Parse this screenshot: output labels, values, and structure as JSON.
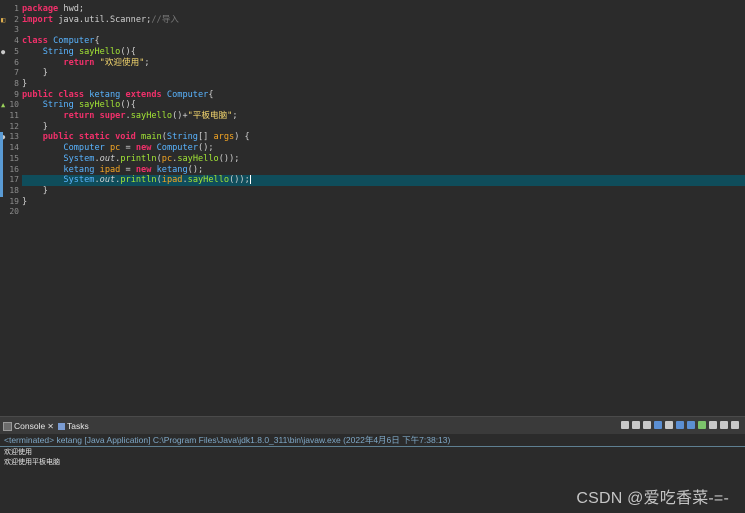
{
  "editor": {
    "line_numbers": [
      "1",
      "2",
      "3",
      "4",
      "5",
      "6",
      "7",
      "8",
      "9",
      "10",
      "11",
      "12",
      "13",
      "14",
      "15",
      "16",
      "17",
      "18",
      "19",
      "20"
    ],
    "code_tokens": {
      "l1": [
        {
          "t": "kw",
          "v": "package"
        },
        {
          "t": "def",
          "v": " hwd;"
        }
      ],
      "l2": [
        {
          "t": "kw",
          "v": "import"
        },
        {
          "t": "def",
          "v": " java.util.Scanner;"
        },
        {
          "t": "cm",
          "v": "//导入"
        }
      ],
      "l3": [],
      "l4": [
        {
          "t": "kw",
          "v": "class"
        },
        {
          "t": "def",
          "v": " "
        },
        {
          "t": "ty",
          "v": "Computer"
        },
        {
          "t": "def",
          "v": "{"
        }
      ],
      "l5": [
        {
          "t": "def",
          "v": "    "
        },
        {
          "t": "ty",
          "v": "String"
        },
        {
          "t": "def",
          "v": " "
        },
        {
          "t": "fn",
          "v": "sayHello"
        },
        {
          "t": "def",
          "v": "(){"
        }
      ],
      "l6": [
        {
          "t": "def",
          "v": "        "
        },
        {
          "t": "kw",
          "v": "return"
        },
        {
          "t": "def",
          "v": " "
        },
        {
          "t": "str",
          "v": "\"欢迎使用\""
        },
        {
          "t": "def",
          "v": ";"
        }
      ],
      "l7": [
        {
          "t": "def",
          "v": "    }"
        }
      ],
      "l8": [
        {
          "t": "def",
          "v": "}"
        }
      ],
      "l9": [
        {
          "t": "kw",
          "v": "public class"
        },
        {
          "t": "def",
          "v": " "
        },
        {
          "t": "ty",
          "v": "ketang"
        },
        {
          "t": "def",
          "v": " "
        },
        {
          "t": "kw",
          "v": "extends"
        },
        {
          "t": "def",
          "v": " "
        },
        {
          "t": "ty",
          "v": "Computer"
        },
        {
          "t": "def",
          "v": "{"
        }
      ],
      "l10": [
        {
          "t": "def",
          "v": "    "
        },
        {
          "t": "ty",
          "v": "String"
        },
        {
          "t": "def",
          "v": " "
        },
        {
          "t": "fn",
          "v": "sayHello"
        },
        {
          "t": "def",
          "v": "(){"
        }
      ],
      "l11": [
        {
          "t": "def",
          "v": "        "
        },
        {
          "t": "kw",
          "v": "return super"
        },
        {
          "t": "def",
          "v": "."
        },
        {
          "t": "fn",
          "v": "sayHello"
        },
        {
          "t": "def",
          "v": "()+"
        },
        {
          "t": "str",
          "v": "\"平板电脑\""
        },
        {
          "t": "def",
          "v": ";"
        }
      ],
      "l12": [
        {
          "t": "def",
          "v": "    }"
        }
      ],
      "l13": [
        {
          "t": "def",
          "v": "    "
        },
        {
          "t": "kw",
          "v": "public static void"
        },
        {
          "t": "def",
          "v": " "
        },
        {
          "t": "fn",
          "v": "main"
        },
        {
          "t": "def",
          "v": "("
        },
        {
          "t": "ty",
          "v": "String"
        },
        {
          "t": "def",
          "v": "[] "
        },
        {
          "t": "st",
          "v": "args"
        },
        {
          "t": "def",
          "v": ") {"
        }
      ],
      "l14": [
        {
          "t": "def",
          "v": "        "
        },
        {
          "t": "ty",
          "v": "Computer"
        },
        {
          "t": "def",
          "v": " "
        },
        {
          "t": "st",
          "v": "pc"
        },
        {
          "t": "def",
          "v": " = "
        },
        {
          "t": "kw",
          "v": "new"
        },
        {
          "t": "def",
          "v": " "
        },
        {
          "t": "ty",
          "v": "Computer"
        },
        {
          "t": "def",
          "v": "();"
        }
      ],
      "l15": [
        {
          "t": "def",
          "v": "        "
        },
        {
          "t": "ty",
          "v": "System"
        },
        {
          "t": "def",
          "v": "."
        },
        {
          "t": "it",
          "v": "out"
        },
        {
          "t": "def",
          "v": "."
        },
        {
          "t": "fn",
          "v": "println"
        },
        {
          "t": "def",
          "v": "("
        },
        {
          "t": "st",
          "v": "pc"
        },
        {
          "t": "def",
          "v": "."
        },
        {
          "t": "fn",
          "v": "sayHello"
        },
        {
          "t": "def",
          "v": "());"
        }
      ],
      "l16": [
        {
          "t": "def",
          "v": "        "
        },
        {
          "t": "ty",
          "v": "ketang"
        },
        {
          "t": "def",
          "v": " "
        },
        {
          "t": "st",
          "v": "ipad"
        },
        {
          "t": "def",
          "v": " = "
        },
        {
          "t": "kw",
          "v": "new"
        },
        {
          "t": "def",
          "v": " "
        },
        {
          "t": "ty",
          "v": "ketang"
        },
        {
          "t": "def",
          "v": "();"
        }
      ],
      "l17": [
        {
          "t": "def",
          "v": "        "
        },
        {
          "t": "ty",
          "v": "System"
        },
        {
          "t": "def",
          "v": "."
        },
        {
          "t": "it",
          "v": "out"
        },
        {
          "t": "def",
          "v": "."
        },
        {
          "t": "fn",
          "v": "println"
        },
        {
          "t": "def",
          "v": "("
        },
        {
          "t": "st",
          "v": "ipad"
        },
        {
          "t": "def",
          "v": "."
        },
        {
          "t": "fn",
          "v": "sayHello"
        },
        {
          "t": "def",
          "v": "());"
        },
        {
          "t": "cursor",
          "v": ""
        }
      ],
      "l18": [
        {
          "t": "def",
          "v": "    }"
        }
      ],
      "l19": [
        {
          "t": "def",
          "v": "}"
        }
      ],
      "l20": []
    },
    "current_line": 17,
    "colors": {
      "keyword": "#f0306a",
      "type": "#59b4ff",
      "method": "#a3e635",
      "string": "#f5d76e",
      "variable": "#f5a623",
      "comment": "#777777",
      "current_line_bg": "#0f4d5b"
    }
  },
  "console": {
    "tab_console": "Console",
    "tab_tasks": "Tasks",
    "header": "<terminated> ketang [Java Application] C:\\Program Files\\Java\\jdk1.8.0_311\\bin\\javaw.exe (2022年4月6日 下午7:38:13)",
    "output_lines": [
      "欢迎使用",
      "欢迎使用平板电脑"
    ],
    "toolbar_icons": [
      "clear-icon",
      "remove-icon",
      "remove-all-icon",
      "scroll-lock-icon",
      "word-wrap-icon",
      "pin-icon",
      "display-selected-icon",
      "open-console-icon",
      "new-console-icon",
      "minimize-icon",
      "maximize-icon"
    ]
  },
  "watermark": "CSDN @爱吃香菜-=-"
}
